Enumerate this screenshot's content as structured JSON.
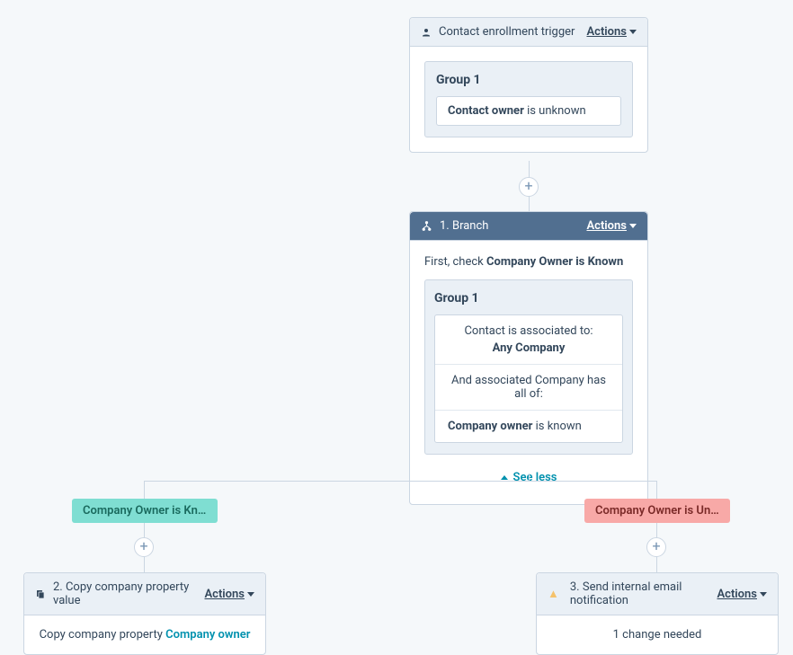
{
  "actions_label": "Actions",
  "trigger": {
    "title": "Contact enrollment trigger",
    "group_title": "Group 1",
    "filter_label": "Contact owner",
    "filter_condition": " is unknown"
  },
  "branch": {
    "step": "1.",
    "title": "Branch",
    "intro_prefix": "First, check ",
    "intro_bold": "Company Owner is Known",
    "group_title": "Group 1",
    "assoc_line": "Contact is associated to:",
    "assoc_target": "Any Company",
    "and_line": "And associated Company has all of:",
    "prop_label": "Company owner",
    "prop_condition": " is known",
    "see_less": "See less"
  },
  "left": {
    "pill": "Company Owner is Known",
    "step": "2.",
    "title": "Copy company property value",
    "body_prefix": "Copy company property ",
    "body_link": "Company owner"
  },
  "right": {
    "pill": "Company Owner is Unkno…",
    "step": "3.",
    "title": "Send internal email notification",
    "body": "1 change needed"
  }
}
